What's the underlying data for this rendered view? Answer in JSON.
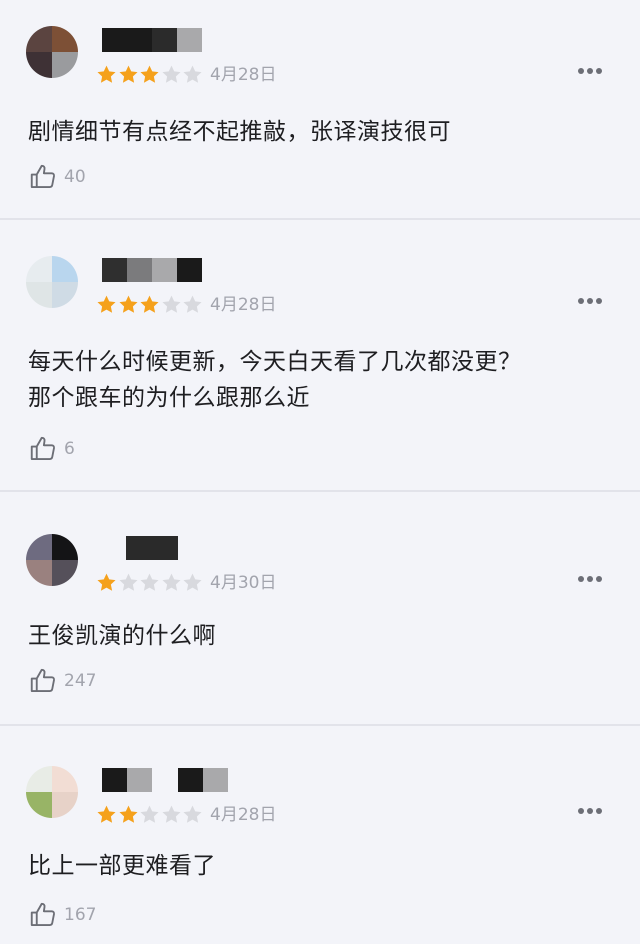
{
  "colors": {
    "background": "#f3f4f9",
    "star_filled": "#f5a11c",
    "star_empty": "#d8d9de",
    "muted_text": "#a2a4ad"
  },
  "reviews": [
    {
      "rating": 3,
      "date": "4月28日",
      "lines": [
        "剧情细节有点经不起推敲，张译演技很可"
      ],
      "likes": "40"
    },
    {
      "rating": 3,
      "date": "4月28日",
      "lines": [
        "每天什么时候更新，今天白天看了几次都没更？",
        "那个跟车的为什么跟那么近"
      ],
      "likes": "6"
    },
    {
      "rating": 1,
      "date": "4月30日",
      "lines": [
        "王俊凯演的什么啊"
      ],
      "likes": "247"
    },
    {
      "rating": 2,
      "date": "4月28日",
      "lines": [
        "比上一部更难看了"
      ],
      "likes": "167"
    }
  ]
}
